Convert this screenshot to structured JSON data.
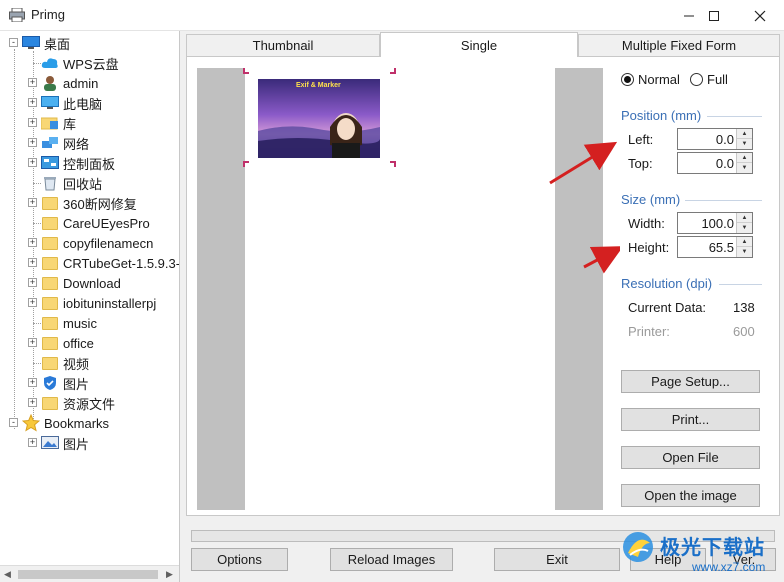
{
  "window": {
    "title": "Primg"
  },
  "tree": {
    "items": [
      {
        "label": "桌面",
        "icon": "desktop-icon"
      },
      {
        "label": "WPS云盘",
        "icon": "cloud-icon"
      },
      {
        "label": "admin",
        "icon": "user-icon"
      },
      {
        "label": "此电脑",
        "icon": "computer-icon"
      },
      {
        "label": "库",
        "icon": "library-icon"
      },
      {
        "label": "网络",
        "icon": "network-icon"
      },
      {
        "label": "控制面板",
        "icon": "control-panel-icon"
      },
      {
        "label": "回收站",
        "icon": "recycle-bin-icon"
      },
      {
        "label": "360断网修复",
        "icon": "folder-icon"
      },
      {
        "label": "CareUEyesPro",
        "icon": "folder-icon"
      },
      {
        "label": "copyfilenamecn",
        "icon": "folder-icon"
      },
      {
        "label": "CRTubeGet-1.5.9.3-",
        "icon": "folder-icon"
      },
      {
        "label": "Download",
        "icon": "folder-icon"
      },
      {
        "label": "iobituninstallerpj",
        "icon": "folder-icon"
      },
      {
        "label": "music",
        "icon": "folder-icon"
      },
      {
        "label": "office",
        "icon": "folder-icon"
      },
      {
        "label": "视频",
        "icon": "folder-icon"
      },
      {
        "label": "图片",
        "icon": "shield-folder-icon"
      },
      {
        "label": "资源文件",
        "icon": "folder-icon"
      },
      {
        "label": "Bookmarks",
        "icon": "star-icon"
      },
      {
        "label": "图片",
        "icon": "picture-icon"
      }
    ]
  },
  "tabs": [
    {
      "label": "Thumbnail"
    },
    {
      "label": "Single"
    },
    {
      "label": "Multiple Fixed Form"
    }
  ],
  "preview": {
    "photo_caption": "Exif & Marker"
  },
  "panel": {
    "mode_normal": "Normal",
    "mode_full": "Full",
    "position_title": "Position (mm)",
    "left_label": "Left:",
    "left_value": "0.0",
    "top_label": "Top:",
    "top_value": "0.0",
    "size_title": "Size (mm)",
    "width_label": "Width:",
    "width_value": "100.0",
    "height_label": "Height:",
    "height_value": "65.5",
    "resolution_title": "Resolution (dpi)",
    "current_label": "Current Data:",
    "current_value": "138",
    "printer_label": "Printer:",
    "printer_value": "600",
    "page_setup": "Page Setup...",
    "print": "Print...",
    "open_file": "Open File",
    "open_image": "Open the image"
  },
  "bottom": {
    "options": "Options",
    "reload": "Reload Images",
    "exit": "Exit",
    "help": "Help",
    "ver": "Ver."
  },
  "watermark": {
    "text": "极光下载站",
    "url": "www.xz7.com"
  },
  "colors": {
    "accent_blue": "#3a6fb5",
    "arrow_red": "#d42020",
    "crop_mark": "#c0306a"
  }
}
